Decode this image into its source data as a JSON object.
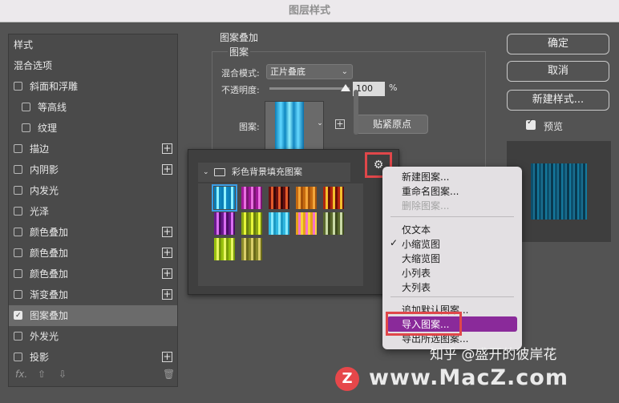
{
  "window": {
    "title": "图层样式"
  },
  "styles_panel": {
    "header": "样式",
    "blend_options": "混合选项",
    "items": [
      {
        "label": "斜面和浮雕",
        "checked": false,
        "indent": false,
        "plus": false
      },
      {
        "label": "等高线",
        "checked": false,
        "indent": true,
        "plus": false
      },
      {
        "label": "纹理",
        "checked": false,
        "indent": true,
        "plus": false
      },
      {
        "label": "描边",
        "checked": false,
        "indent": false,
        "plus": true
      },
      {
        "label": "内阴影",
        "checked": false,
        "indent": false,
        "plus": true
      },
      {
        "label": "内发光",
        "checked": false,
        "indent": false,
        "plus": false
      },
      {
        "label": "光泽",
        "checked": false,
        "indent": false,
        "plus": false
      },
      {
        "label": "颜色叠加",
        "checked": false,
        "indent": false,
        "plus": true
      },
      {
        "label": "颜色叠加",
        "checked": false,
        "indent": false,
        "plus": true
      },
      {
        "label": "颜色叠加",
        "checked": false,
        "indent": false,
        "plus": true
      },
      {
        "label": "渐变叠加",
        "checked": false,
        "indent": false,
        "plus": true
      },
      {
        "label": "图案叠加",
        "checked": true,
        "indent": false,
        "plus": false,
        "selected": true
      },
      {
        "label": "外发光",
        "checked": false,
        "indent": false,
        "plus": false
      },
      {
        "label": "投影",
        "checked": false,
        "indent": false,
        "plus": true
      }
    ],
    "plus_glyph": "+",
    "bottom_fx": "fx.",
    "bottom_icons": [
      "up-arrow-icon",
      "down-arrow-icon",
      "trash-icon"
    ]
  },
  "pattern_overlay": {
    "group_title": "图案叠加",
    "sub_title": "图案",
    "blend_mode_label": "混合模式:",
    "blend_mode_value": "正片叠底",
    "opacity_label": "不透明度:",
    "opacity_value": "100",
    "opacity_unit": "%",
    "opacity_level": 1.0,
    "pattern_label": "图案:",
    "snap_button": "贴紧原点"
  },
  "right_buttons": {
    "ok": "确定",
    "cancel": "取消",
    "new_style": "新建样式...",
    "preview_label": "预览"
  },
  "pattern_picker": {
    "group_name": "彩色背景填充图案",
    "gear_icon": "gear-icon",
    "thumbs": [
      {
        "colors": [
          "#0a7fb8",
          "#8ef0ff",
          "#0e86c0"
        ],
        "selected": true
      },
      {
        "colors": [
          "#a2189a",
          "#e96fe0",
          "#7b1573"
        ]
      },
      {
        "colors": [
          "#6a1010",
          "#e25a2a",
          "#3a0808"
        ]
      },
      {
        "colors": [
          "#c66a10",
          "#f3a63a",
          "#a3510a"
        ]
      },
      {
        "colors": [
          "#b2260e",
          "#f4c02c",
          "#6a0f07"
        ]
      },
      {
        "colors": [
          "#6a1a8e",
          "#d96df2",
          "#4a0d66"
        ]
      },
      {
        "colors": [
          "#8aa612",
          "#e7f53a",
          "#6a800c"
        ]
      },
      {
        "colors": [
          "#2fb7e0",
          "#87eaff",
          "#1c9ac4"
        ]
      },
      {
        "colors": [
          "#e6a21a",
          "#f572c8",
          "#f8d23a"
        ]
      },
      {
        "colors": [
          "#5a6a2e",
          "#c9d9a6",
          "#3d4a1c"
        ]
      },
      {
        "colors": [
          "#9ac20e",
          "#e8f562",
          "#789a08"
        ]
      },
      {
        "colors": [
          "#8a8a2a",
          "#d9cd6a",
          "#6a6a1a"
        ]
      }
    ]
  },
  "context_menu": {
    "items": [
      {
        "label": "新建图案...",
        "disabled": false
      },
      {
        "label": "重命名图案...",
        "disabled": false
      },
      {
        "label": "删除图案...",
        "disabled": true
      },
      {
        "label": "仅文本",
        "disabled": false
      },
      {
        "label": "小缩览图",
        "disabled": false,
        "checked": true
      },
      {
        "label": "大缩览图",
        "disabled": false
      },
      {
        "label": "小列表",
        "disabled": false
      },
      {
        "label": "大列表",
        "disabled": false
      },
      {
        "label": "追加默认图案...",
        "disabled": false
      },
      {
        "label": "导入图案...",
        "disabled": false,
        "highlighted": true
      },
      {
        "label": "导出所选图案...",
        "disabled": false
      }
    ],
    "check_glyph": "✓"
  },
  "watermark": {
    "logo_letter": "Z",
    "domain": "www.MacZ.com",
    "zh_text": "知乎 @盛开的彼岸花"
  }
}
